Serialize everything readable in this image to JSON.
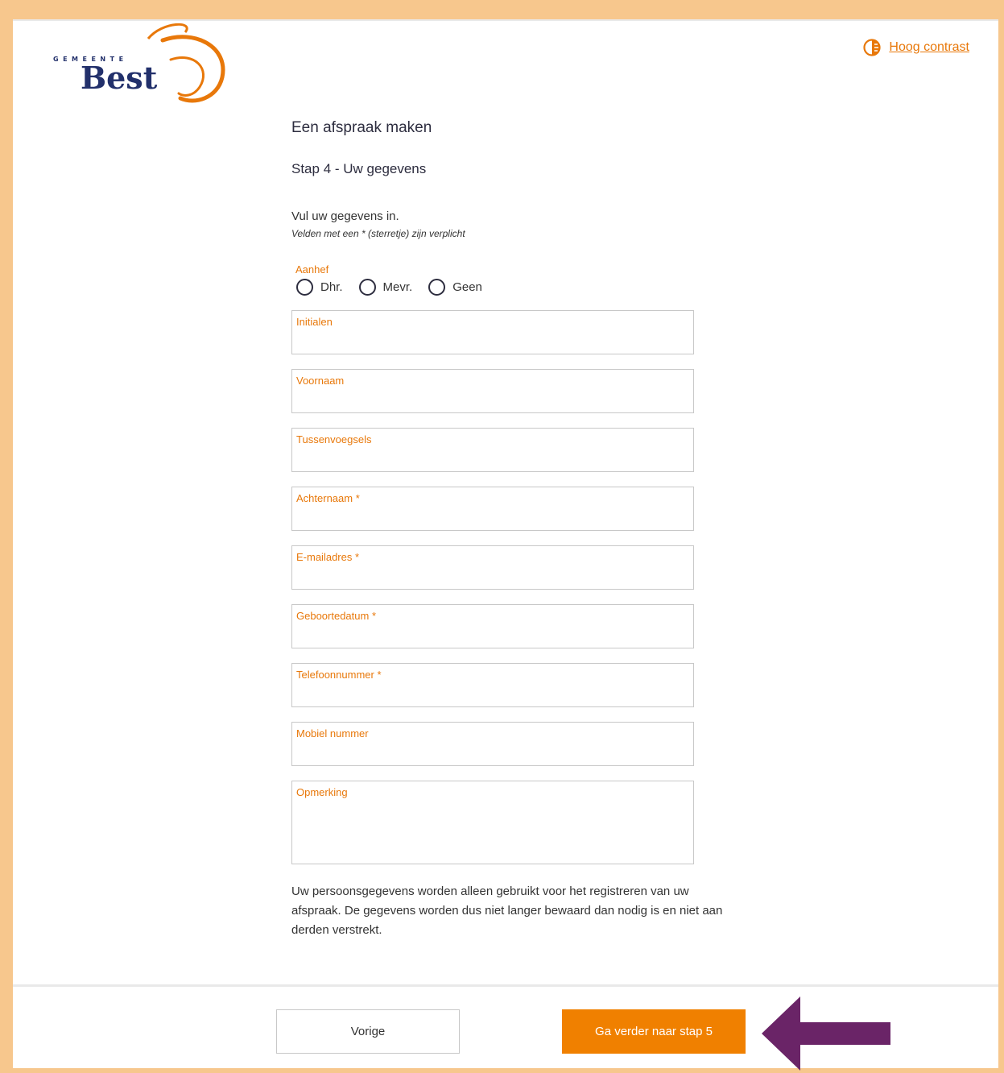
{
  "colors": {
    "accent": "#f08000",
    "label_orange": "#e8780a",
    "frame": "#f7c78d",
    "arrow": "#6a2467",
    "logo_text": "#22306b"
  },
  "header": {
    "logo": {
      "top_text": "GEMEENTE",
      "name": "Best"
    },
    "contrast_icon": "contrast-icon",
    "contrast_label": "Hoog contrast"
  },
  "main": {
    "title": "Een afspraak maken",
    "step": "Stap 4 - Uw gegevens",
    "intro": "Vul uw gegevens in.",
    "required_note": "Velden met een * (sterretje) zijn verplicht",
    "aanhef": {
      "label": "Aanhef",
      "options": [
        "Dhr.",
        "Mevr.",
        "Geen"
      ]
    },
    "fields": {
      "initialen": {
        "label": "Initialen",
        "value": ""
      },
      "voornaam": {
        "label": "Voornaam",
        "value": ""
      },
      "tussenvoegsels": {
        "label": "Tussenvoegsels",
        "value": ""
      },
      "achternaam": {
        "label": "Achternaam *",
        "value": ""
      },
      "email": {
        "label": "E-mailadres *",
        "value": ""
      },
      "geboortedatum": {
        "label": "Geboortedatum *",
        "value": ""
      },
      "telefoon": {
        "label": "Telefoonnummer *",
        "value": ""
      },
      "mobiel": {
        "label": "Mobiel nummer",
        "value": ""
      },
      "opmerking": {
        "label": "Opmerking",
        "value": ""
      }
    },
    "privacy": "Uw persoonsgegevens worden alleen gebruikt voor het registreren van uw afspraak. De gegevens worden dus niet langer bewaard dan nodig is en niet aan derden verstrekt."
  },
  "footer": {
    "prev_label": "Vorige",
    "next_label": "Ga verder naar stap 5"
  }
}
